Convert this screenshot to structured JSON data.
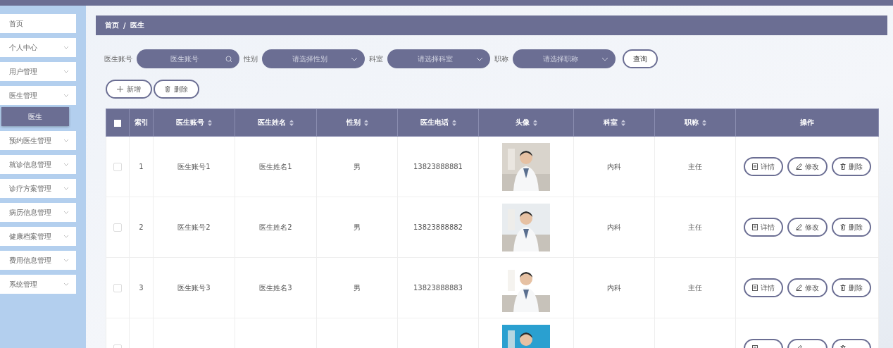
{
  "sidebar": {
    "items": [
      {
        "label": "首页",
        "kind": "link"
      },
      {
        "label": "个人中心",
        "kind": "submenu"
      },
      {
        "label": "用户管理",
        "kind": "submenu"
      },
      {
        "label": "医生管理",
        "kind": "submenu",
        "children": [
          {
            "label": "医生",
            "selected": true
          }
        ]
      },
      {
        "label": "预约医生管理",
        "kind": "submenu"
      },
      {
        "label": "就诊信息管理",
        "kind": "submenu"
      },
      {
        "label": "诊疗方案管理",
        "kind": "submenu"
      },
      {
        "label": "病历信息管理",
        "kind": "submenu"
      },
      {
        "label": "健康档案管理",
        "kind": "submenu"
      },
      {
        "label": "费用信息管理",
        "kind": "submenu"
      },
      {
        "label": "系统管理",
        "kind": "submenu"
      }
    ]
  },
  "breadcrumb": [
    "首页",
    "/",
    "医生"
  ],
  "filters": [
    {
      "label": "医生账号",
      "kind": "input",
      "placeholder": "医生账号"
    },
    {
      "label": "性别",
      "kind": "select",
      "placeholder": "请选择性别"
    },
    {
      "label": "科室",
      "kind": "select",
      "placeholder": "请选择科室"
    },
    {
      "label": "职称",
      "kind": "select",
      "placeholder": "请选择职称"
    }
  ],
  "query_button": "查询",
  "toolbar": [
    {
      "label": "新增",
      "kind": "add"
    },
    {
      "label": "删除",
      "kind": "delete"
    }
  ],
  "table": {
    "header_checked": false,
    "columns": [
      {
        "label": "索引",
        "sortable": false
      },
      {
        "label": "医生账号",
        "sortable": true
      },
      {
        "label": "医生姓名",
        "sortable": true
      },
      {
        "label": "性别",
        "sortable": true
      },
      {
        "label": "医生电话",
        "sortable": true
      },
      {
        "label": "头像",
        "sortable": true
      },
      {
        "label": "科室",
        "sortable": true
      },
      {
        "label": "职称",
        "sortable": true
      },
      {
        "label": "操作",
        "sortable": false
      }
    ],
    "rows": [
      {
        "checked": false,
        "index": "1",
        "account": "医生账号1",
        "name": "医生姓名1",
        "gender": "男",
        "phone": "13823888881",
        "photo": {
          "kind": "picture"
        },
        "department": "内科",
        "title": "主任",
        "actions": [
          {
            "label": "详情",
            "kind": "detail"
          },
          {
            "label": "修改",
            "kind": "edit"
          },
          {
            "label": "删除",
            "kind": "delete"
          }
        ]
      },
      {
        "checked": false,
        "index": "2",
        "account": "医生账号2",
        "name": "医生姓名2",
        "gender": "男",
        "phone": "13823888882",
        "photo": {
          "kind": "picture"
        },
        "department": "内科",
        "title": "主任",
        "actions": [
          {
            "label": "详情",
            "kind": "detail"
          },
          {
            "label": "修改",
            "kind": "edit"
          },
          {
            "label": "删除",
            "kind": "delete"
          }
        ]
      },
      {
        "checked": false,
        "index": "3",
        "account": "医生账号3",
        "name": "医生姓名3",
        "gender": "男",
        "phone": "13823888883",
        "photo": {
          "kind": "picture"
        },
        "department": "内科",
        "title": "主任",
        "actions": [
          {
            "label": "详情",
            "kind": "detail"
          },
          {
            "label": "修改",
            "kind": "edit"
          },
          {
            "label": "删除",
            "kind": "delete"
          }
        ]
      },
      {
        "checked": false,
        "photo": {
          "kind": "picture"
        },
        "actions": [
          {
            "kind": "detail"
          },
          {
            "kind": "edit"
          },
          {
            "kind": "delete"
          }
        ]
      }
    ]
  }
}
